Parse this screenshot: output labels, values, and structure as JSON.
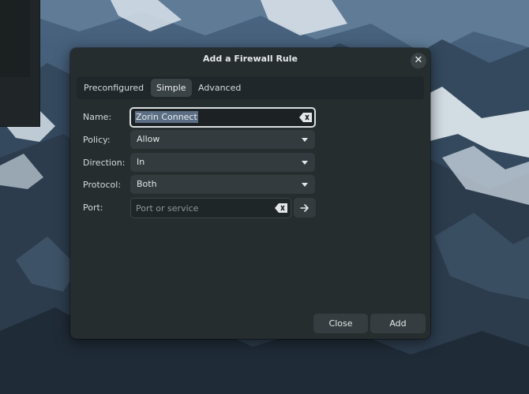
{
  "dialog": {
    "title": "Add a Firewall Rule",
    "close_icon": "close-icon"
  },
  "tabs": [
    {
      "label": "Preconfigured",
      "active": false
    },
    {
      "label": "Simple",
      "active": true
    },
    {
      "label": "Advanced",
      "active": false
    }
  ],
  "form": {
    "name": {
      "label": "Name:",
      "value": "Zorin Connect",
      "clear_icon": "clear-text-icon"
    },
    "policy": {
      "label": "Policy:",
      "value": "Allow"
    },
    "direction": {
      "label": "Direction:",
      "value": "In"
    },
    "protocol": {
      "label": "Protocol:",
      "value": "Both"
    },
    "port": {
      "label": "Port:",
      "value": "",
      "placeholder": "Port or service",
      "go_icon": "arrow-right-icon"
    }
  },
  "footer": {
    "close_label": "Close",
    "add_label": "Add"
  },
  "colors": {
    "dialog_bg": "#262d2f",
    "field_bg": "#333b3e",
    "focus_border": "#d9dfe0",
    "selection": "#5b6e84"
  }
}
